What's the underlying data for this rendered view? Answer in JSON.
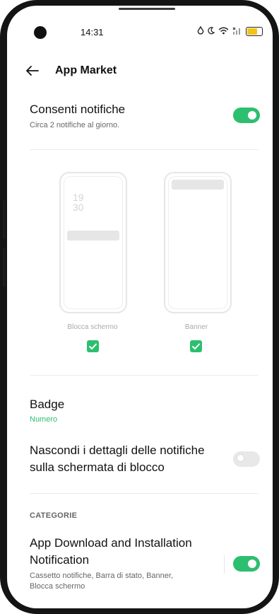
{
  "status_bar": {
    "time": "14:31"
  },
  "header": {
    "title": "App Market"
  },
  "allow_notifications": {
    "title": "Consenti notifiche",
    "subtitle": "Circa 2 notifiche al giorno.",
    "enabled": true
  },
  "previews": {
    "lock_screen": {
      "label": "Blocca schermo",
      "clock_hours": "19",
      "clock_minutes": "30",
      "checked": true
    },
    "banner": {
      "label": "Banner",
      "checked": true
    }
  },
  "badge": {
    "title": "Badge",
    "value": "Numero"
  },
  "hide_details": {
    "title_line1": "Nascondi i dettagli delle notifiche",
    "title_line2": "sulla schermata di blocco",
    "enabled": false
  },
  "categories": {
    "section_label": "CATEGORIE",
    "items": [
      {
        "title_line1": "App Download and Installation",
        "title_line2": "Notification",
        "sub_line1": "Cassetto notifiche, Barra di stato, Banner,",
        "sub_line2": "Blocca schermo",
        "enabled": true
      }
    ]
  },
  "colors": {
    "accent": "#2cbf6f",
    "toggle_off": "#e8e8e8",
    "divider": "#ececec"
  }
}
